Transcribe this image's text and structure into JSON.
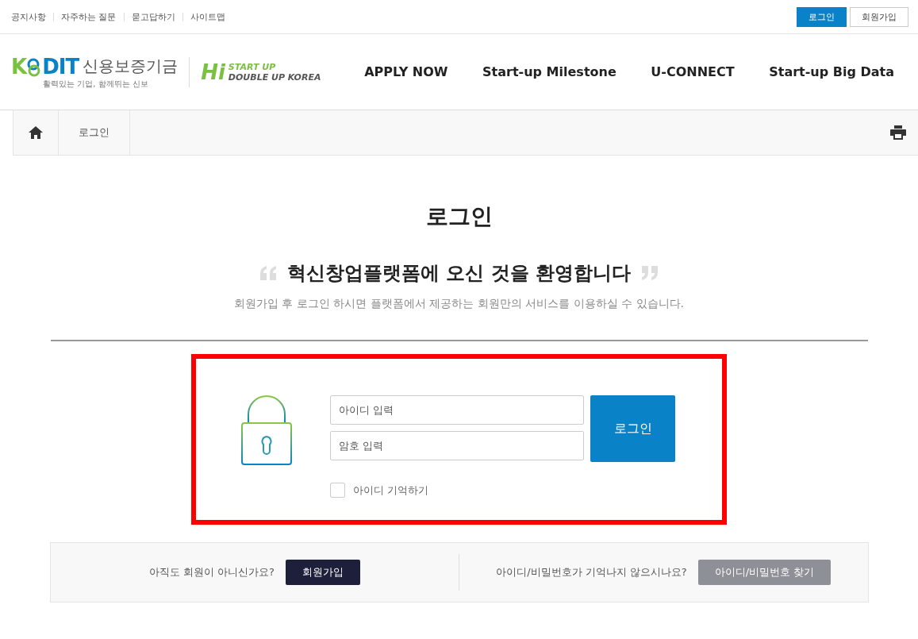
{
  "util_links": [
    "공지사항",
    "자주하는 질문",
    "묻고답하기",
    "사이트맵"
  ],
  "util_buttons": [
    {
      "label": "로그인",
      "selected": true
    },
    {
      "label": "회원가입",
      "selected": false
    }
  ],
  "logo": {
    "k": "K",
    "dit": "DIT",
    "name": "신용보증기금",
    "slogan": "활력있는 기업, 함께뛰는 신보"
  },
  "sub_logo": {
    "hi": "Hi",
    "line1": "START UP",
    "line2": "DOUBLE UP KOREA"
  },
  "nav": [
    "APPLY NOW",
    "Start-up Milestone",
    "U-CONNECT",
    "Start-up Big Data"
  ],
  "breadcrumb": [
    "로그인"
  ],
  "title": "로그인",
  "welcome": "혁신창업플랫폼에 오신 것을 환영합니다",
  "description": "회원가입 후 로그인 하시면 플랫폼에서 제공하는 회원만의 서비스를 이용하실 수 있습니다.",
  "form": {
    "id_placeholder": "아이디 입력",
    "pw_placeholder": "암호 입력",
    "login_button": "로그인",
    "remember": {
      "label": "아이디 기억하기",
      "checked": false
    }
  },
  "help": [
    {
      "question": "아직도 회원이 아니신가요?",
      "button": "회원가입",
      "kind": "primary"
    },
    {
      "question": "아이디/비밀번호가 기억나지 않으시나요?",
      "button": "아이디/비밀번호 찾기",
      "kind": "secondary"
    }
  ]
}
